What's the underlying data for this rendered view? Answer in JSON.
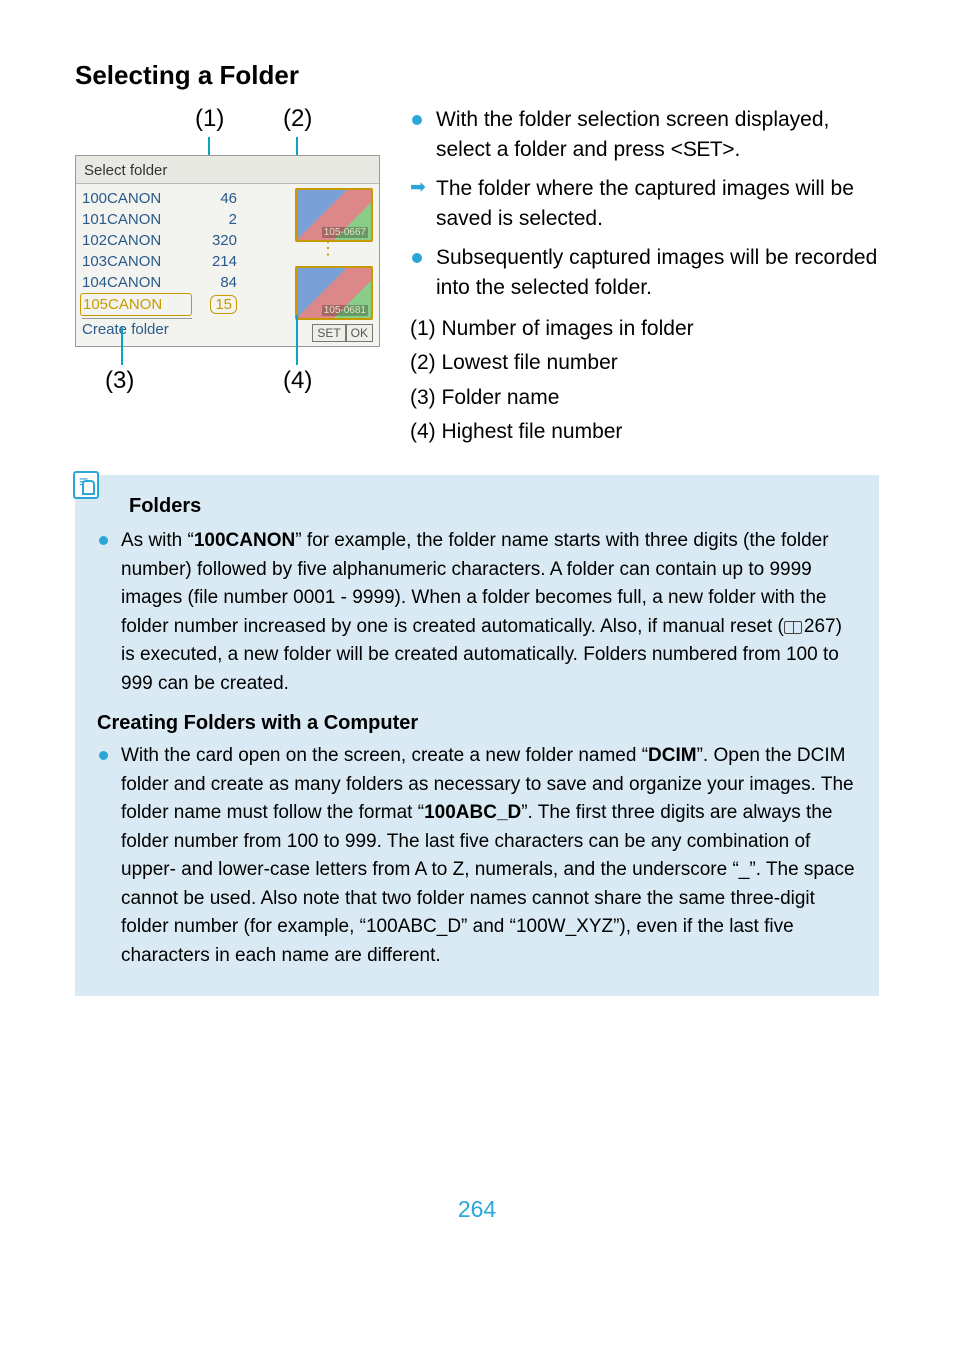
{
  "heading": "Selecting a Folder",
  "screenshot": {
    "callouts": {
      "c1": "(1)",
      "c2": "(2)",
      "c3": "(3)",
      "c4": "(4)"
    },
    "panel_title": "Select folder",
    "rows": [
      {
        "name": "100CANON",
        "count": "46"
      },
      {
        "name": "101CANON",
        "count": "2"
      },
      {
        "name": "102CANON",
        "count": "320"
      },
      {
        "name": "103CANON",
        "count": "214"
      },
      {
        "name": "104CANON",
        "count": "84"
      },
      {
        "name": "105CANON",
        "count": "15"
      }
    ],
    "create_label": "Create folder",
    "thumb_labels": {
      "t1": "105-0667",
      "t2": "105-0681"
    },
    "set_label": "SET",
    "ok_label": "OK"
  },
  "bullets": {
    "b1_pre": "With the folder selection screen displayed, select a folder and press <",
    "b1_set": "SET",
    "b1_post": ">.",
    "b2": "The folder where the captured images will be saved is selected.",
    "b3": "Subsequently captured images will be recorded into the selected folder."
  },
  "legend": {
    "l1": "(1) Number of images in folder",
    "l2": "(2) Lowest file number",
    "l3": "(3) Folder name",
    "l4": "(4) Highest file number"
  },
  "notes": {
    "folders_heading": "Folders",
    "folders_body_pre": "As with “",
    "folders_body_bold": "100CANON",
    "folders_body_mid": "” for example, the folder name starts with three digits (the folder number) followed by five alphanumeric characters. A folder can contain up to 9999 images (file number 0001 - 9999). When a folder becomes full, a new folder with the folder number increased by one is created automatically. Also, if manual reset (",
    "folders_body_page": "267",
    "folders_body_post": ") is executed, a new folder will be created automatically. Folders numbered from 100 to 999 can be created.",
    "creating_heading": "Creating Folders with a Computer",
    "creating_body_pre": "With the card open on the screen, create a new folder named “",
    "creating_body_bold1": "DCIM",
    "creating_body_mid1": "”. Open the DCIM folder and create as many folders as necessary to save and organize your images. The folder name must follow the format “",
    "creating_body_bold2": "100ABC_D",
    "creating_body_post": "”. The first three digits are always the folder number from 100 to 999. The last five characters can be any combination of upper- and lower-case letters from A to Z, numerals, and the underscore “_”. The space cannot be used. Also note that two folder names cannot share the same three-digit folder number (for example, “100ABC_D” and “100W_XYZ”), even if the last five characters in each name are different."
  },
  "page_number": "264"
}
